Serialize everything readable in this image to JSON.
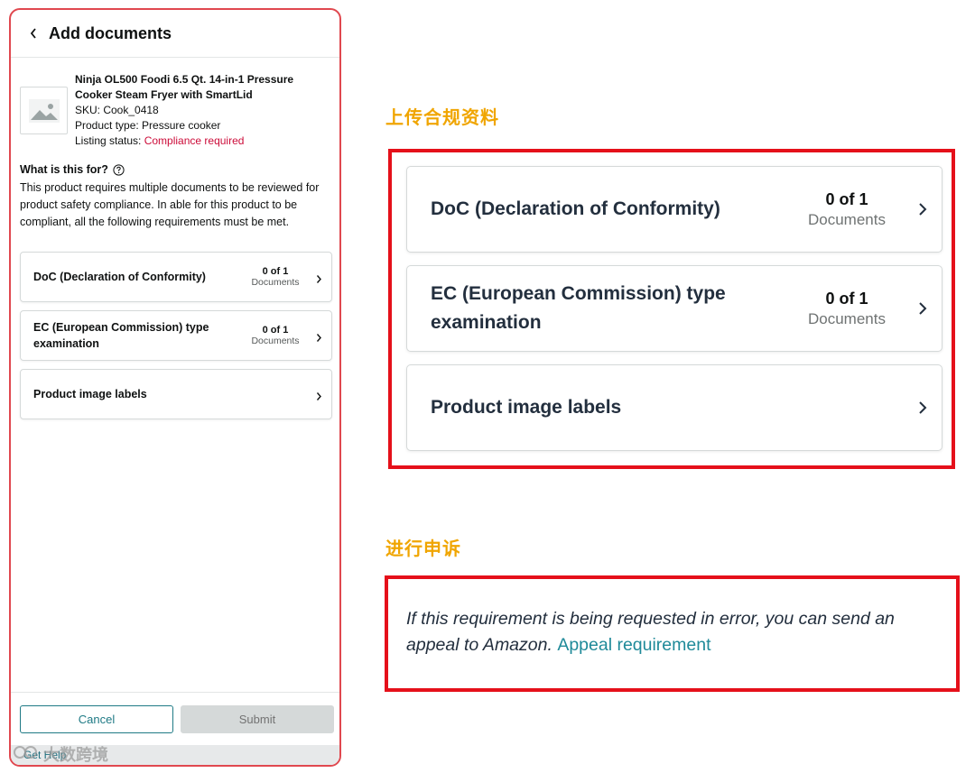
{
  "phone": {
    "title": "Add documents",
    "product": {
      "name": "Ninja OL500 Foodi 6.5 Qt. 14-in-1 Pressure Cooker Steam Fryer with SmartLid",
      "sku": "SKU: Cook_0418",
      "type": "Product type: Pressure cooker",
      "status_label": "Listing status: ",
      "status_value": "Compliance required",
      "image_icon": "image-placeholder-icon"
    },
    "what": {
      "title": "What is this for?",
      "body": "This product requires multiple documents to be reviewed for product safety compliance. In able for this product to be compliant, all the following requirements must be met."
    },
    "requirements": [
      {
        "label": "DoC (Declaration of Conformity)",
        "count": "0 of 1",
        "unit": "Documents"
      },
      {
        "label": "EC (European Commission) type examination",
        "count": "0 of 1",
        "unit": "Documents"
      },
      {
        "label": "Product image labels",
        "count": "",
        "unit": ""
      }
    ],
    "buttons": {
      "cancel": "Cancel",
      "submit": "Submit"
    },
    "get_help": "Get Help",
    "watermark": "大数跨境"
  },
  "annotations": {
    "upload_title": "上传合规资料",
    "appeal_title": "进行申诉",
    "appeal_text": "If this requirement is being requested in error, you can send an appeal to Amazon.",
    "appeal_link": "Appeal requirement"
  },
  "colors": {
    "alert": "#cc0c39",
    "link": "#1f8a99",
    "annotation_title": "#f0a500",
    "annotation_border": "#e5101a"
  }
}
